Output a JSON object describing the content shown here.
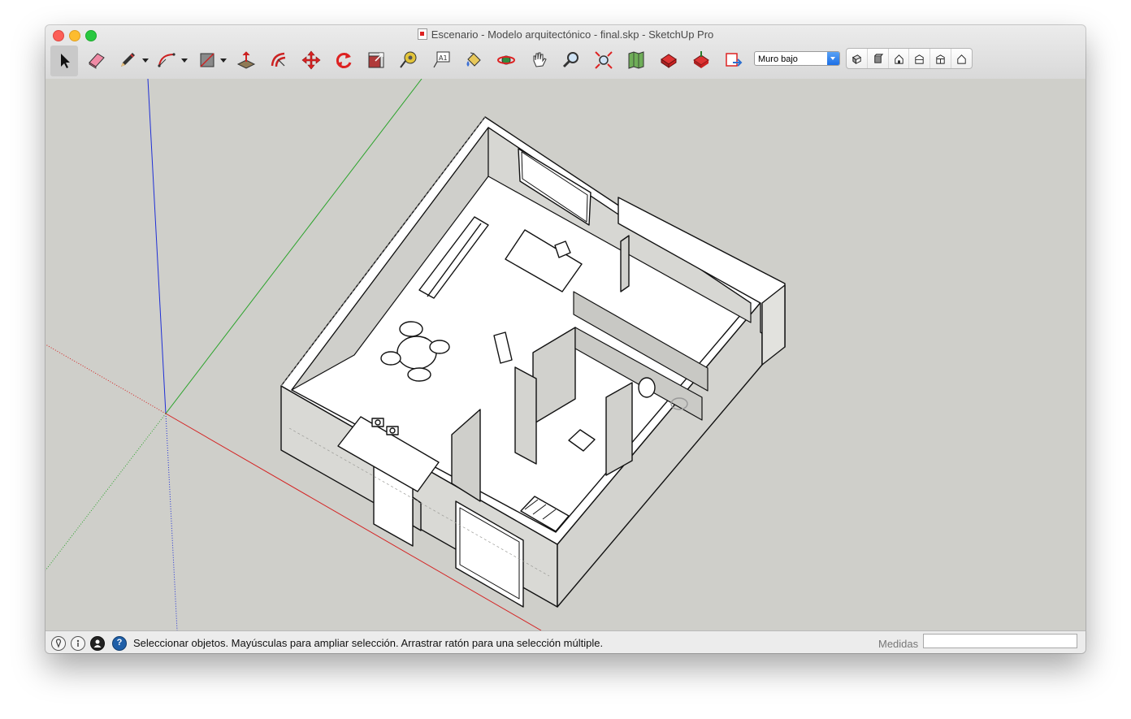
{
  "window": {
    "title": "Escenario - Modelo arquitectónico - final.skp - SketchUp Pro"
  },
  "toolbar": {
    "tools": [
      {
        "name": "select-tool",
        "icon": "arrow-cursor-icon"
      },
      {
        "name": "eraser-tool",
        "icon": "eraser-icon"
      },
      {
        "name": "line-tool",
        "icon": "pencil-icon"
      },
      {
        "name": "arc-tool",
        "icon": "arc-icon"
      },
      {
        "name": "rectangle-tool",
        "icon": "rectangle-icon"
      },
      {
        "name": "push-pull-tool",
        "icon": "push-pull-icon"
      },
      {
        "name": "offset-tool",
        "icon": "offset-icon"
      },
      {
        "name": "move-tool",
        "icon": "move-arrows-icon"
      },
      {
        "name": "rotate-tool",
        "icon": "rotate-icon"
      },
      {
        "name": "scale-tool",
        "icon": "scale-icon"
      },
      {
        "name": "tape-measure-tool",
        "icon": "tape-measure-icon"
      },
      {
        "name": "text-tool",
        "icon": "text-label-icon"
      },
      {
        "name": "paint-bucket-tool",
        "icon": "paint-bucket-icon"
      },
      {
        "name": "orbit-tool",
        "icon": "orbit-icon"
      },
      {
        "name": "pan-tool",
        "icon": "hand-icon"
      },
      {
        "name": "zoom-tool",
        "icon": "magnifier-icon"
      },
      {
        "name": "zoom-extents-tool",
        "icon": "zoom-extents-icon"
      },
      {
        "name": "add-location-tool",
        "icon": "map-icon"
      },
      {
        "name": "warehouse-tool",
        "icon": "warehouse-icon"
      },
      {
        "name": "share-model-tool",
        "icon": "share-model-icon"
      },
      {
        "name": "send-to-layout-tool",
        "icon": "send-to-layout-icon"
      }
    ],
    "layer_value": "Muro bajo",
    "views": [
      {
        "name": "iso-view",
        "icon": "iso-view-icon"
      },
      {
        "name": "top-view",
        "icon": "top-view-icon"
      },
      {
        "name": "front-view",
        "icon": "front-view-icon"
      },
      {
        "name": "right-view",
        "icon": "right-view-icon"
      },
      {
        "name": "back-view",
        "icon": "back-view-icon"
      },
      {
        "name": "left-view",
        "icon": "left-view-icon"
      }
    ]
  },
  "colors": {
    "axis_blue": "#1f2fd6",
    "axis_green": "#2aa32a",
    "axis_red": "#d42424",
    "viewport_bg": "#cfcfca",
    "wall_face": "#d6d6d2",
    "floor": "#ffffff"
  },
  "status": {
    "icons": [
      "geo-location-icon",
      "credits-icon",
      "user-icon",
      "help-icon"
    ],
    "help_glyph": "?",
    "message": "Seleccionar objetos. Mayúsculas para ampliar selección. Arrastrar ratón para una selección múltiple.",
    "measurements_label": "Medidas",
    "measurements_value": ""
  }
}
